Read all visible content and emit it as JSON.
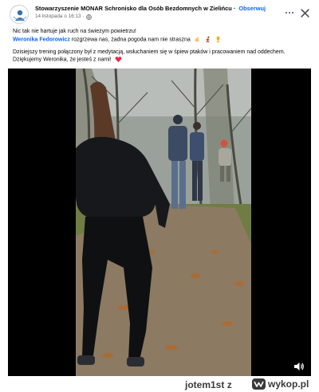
{
  "post": {
    "page_name": "Stowarzyszenie MONAR Schronisko dla Osób Bezdomnych w Zielińcu",
    "separator": "·",
    "follow_label": "Obserwuj",
    "timestamp": "14 listopada o 16:13",
    "line1": "Nic tak nie hartuje jak ruch na świeżym powietrzu!",
    "mention": "Weronika Fedorowicz",
    "line2_rest": " rozgrzewa nas, żadna pogoda nam nie straszna",
    "line3": "Dzisiejszy trening połączony był z medytacją, wsłuchaniem się w śpiew ptaków i pracowaniem nad oddechem.",
    "line4": "Dziękujemy Weronika, że jesteś z nami!"
  },
  "icons": {
    "avatar": "monar-logo-avatar",
    "globe": "globe-icon",
    "more": "more-options-icon",
    "close": "close-icon",
    "volume": "volume-icon",
    "wykop": "wykop-logo-icon"
  },
  "watermark": {
    "user": "jotem1st",
    "separator": "z",
    "site": "wykop.pl"
  },
  "colors": {
    "link": "#0866ff",
    "text": "#050505",
    "meta": "#65676b",
    "video_bg": "#000000",
    "heart": "#f02849"
  }
}
